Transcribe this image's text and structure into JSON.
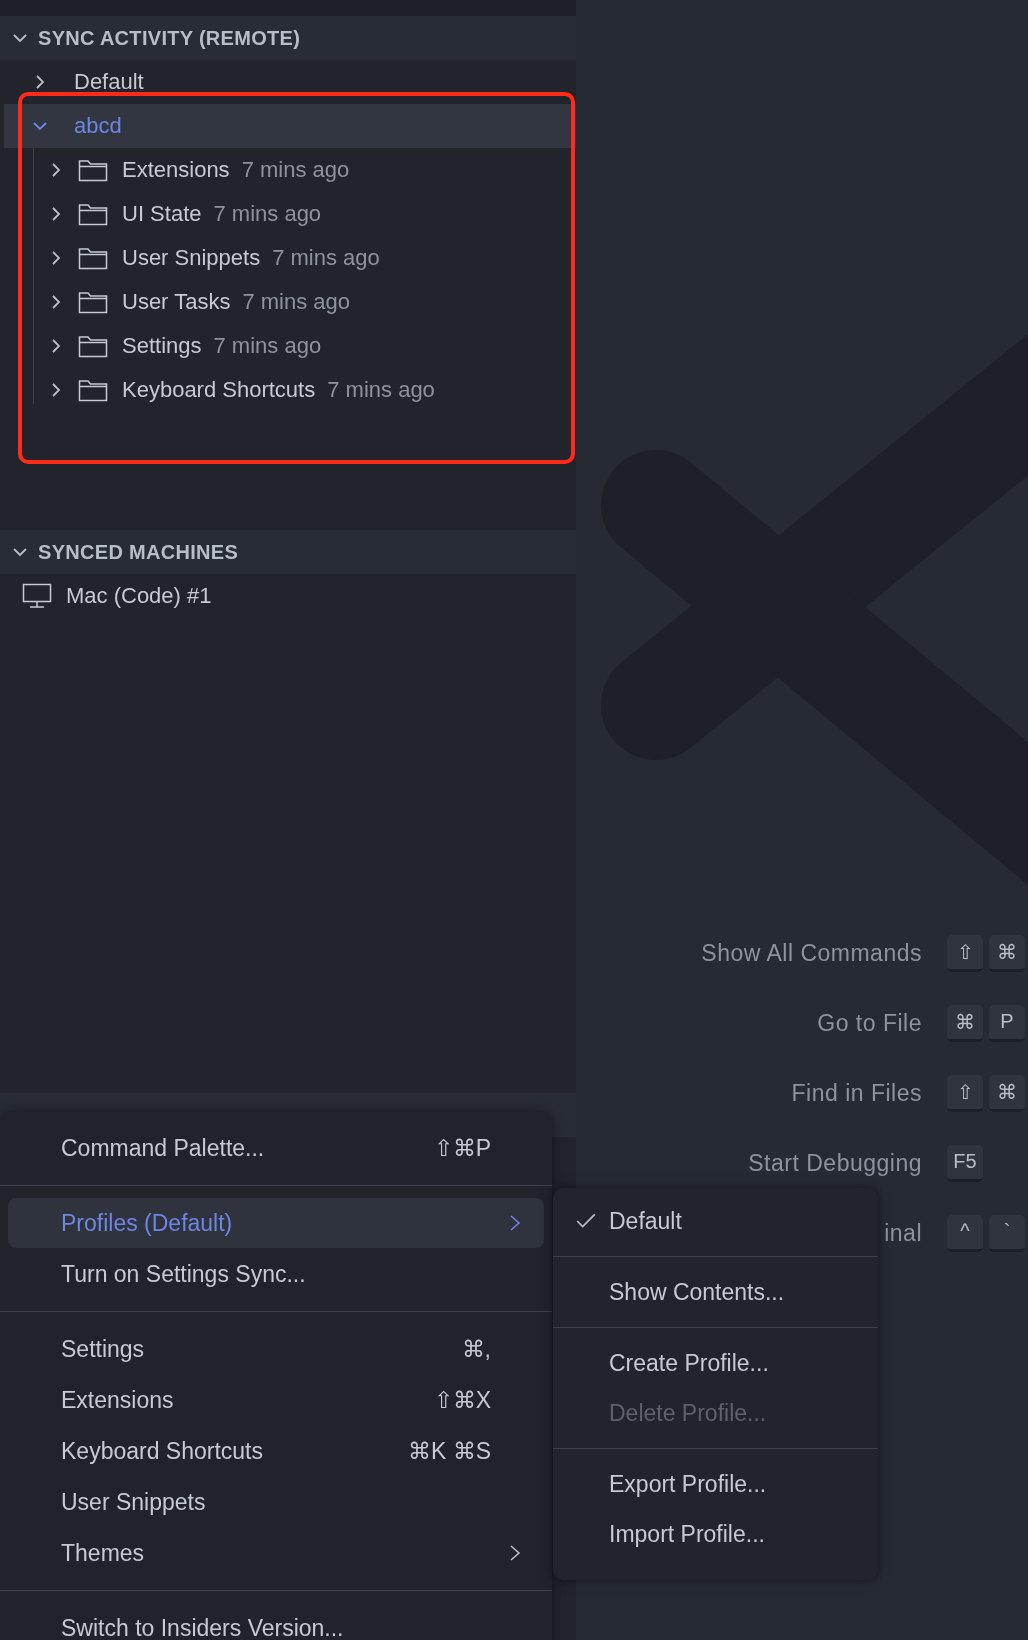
{
  "sidebar": {
    "sections": [
      {
        "kind": "tree",
        "title": "SYNC ACTIVITY (REMOTE)",
        "expanded": true,
        "items": [
          {
            "label": "Default",
            "expanded": false,
            "selected": false
          },
          {
            "label": "abcd",
            "expanded": true,
            "selected": true,
            "children": [
              {
                "label": "Extensions",
                "time": "7 mins ago",
                "expanded": false
              },
              {
                "label": "UI State",
                "time": "7 mins ago",
                "expanded": false
              },
              {
                "label": "User Snippets",
                "time": "7 mins ago",
                "expanded": false
              },
              {
                "label": "User Tasks",
                "time": "7 mins ago",
                "expanded": false
              },
              {
                "label": "Settings",
                "time": "7 mins ago",
                "expanded": false
              },
              {
                "label": "Keyboard Shortcuts",
                "time": "7 mins ago",
                "expanded": false
              }
            ]
          }
        ]
      },
      {
        "kind": "machines",
        "title": "SYNCED MACHINES",
        "expanded": true,
        "items": [
          {
            "label": "Mac (Code) #1"
          }
        ]
      }
    ]
  },
  "shortcut_hints": [
    {
      "label": "Show All Commands",
      "keys": [
        "⇧",
        "⌘"
      ]
    },
    {
      "label": "Go to File",
      "keys": [
        "⌘",
        "P"
      ]
    },
    {
      "label": "Find in Files",
      "keys": [
        "⇧",
        "⌘"
      ]
    },
    {
      "label": "Start Debugging",
      "keys": [
        "F5"
      ]
    },
    {
      "label": "inal",
      "keys": [
        "^",
        "`"
      ]
    }
  ],
  "menu": {
    "groups": [
      [
        {
          "label": "Command Palette...",
          "shortcut": "⇧⌘P",
          "submenu": false,
          "selected": false
        }
      ],
      [
        {
          "label": "Profiles (Default)",
          "submenu": true,
          "selected": true
        },
        {
          "label": "Turn on Settings Sync...",
          "submenu": false,
          "selected": false
        }
      ],
      [
        {
          "label": "Settings",
          "shortcut": "⌘,",
          "submenu": false,
          "selected": false
        },
        {
          "label": "Extensions",
          "shortcut": "⇧⌘X",
          "submenu": false,
          "selected": false
        },
        {
          "label": "Keyboard Shortcuts",
          "shortcut": "⌘K ⌘S",
          "submenu": false,
          "selected": false
        },
        {
          "label": "User Snippets",
          "submenu": false,
          "selected": false
        },
        {
          "label": "Themes",
          "submenu": true,
          "selected": false
        }
      ],
      [
        {
          "label": "Switch to Insiders Version...",
          "submenu": false,
          "selected": false
        }
      ]
    ]
  },
  "submenu": {
    "groups": [
      [
        {
          "label": "Default",
          "checked": true,
          "disabled": false
        }
      ],
      [
        {
          "label": "Show Contents...",
          "checked": false,
          "disabled": false
        }
      ],
      [
        {
          "label": "Create Profile...",
          "checked": false,
          "disabled": false
        },
        {
          "label": "Delete Profile...",
          "checked": false,
          "disabled": true
        }
      ],
      [
        {
          "label": "Export Profile...",
          "checked": false,
          "disabled": false
        },
        {
          "label": "Import Profile...",
          "checked": false,
          "disabled": false
        }
      ]
    ]
  }
}
